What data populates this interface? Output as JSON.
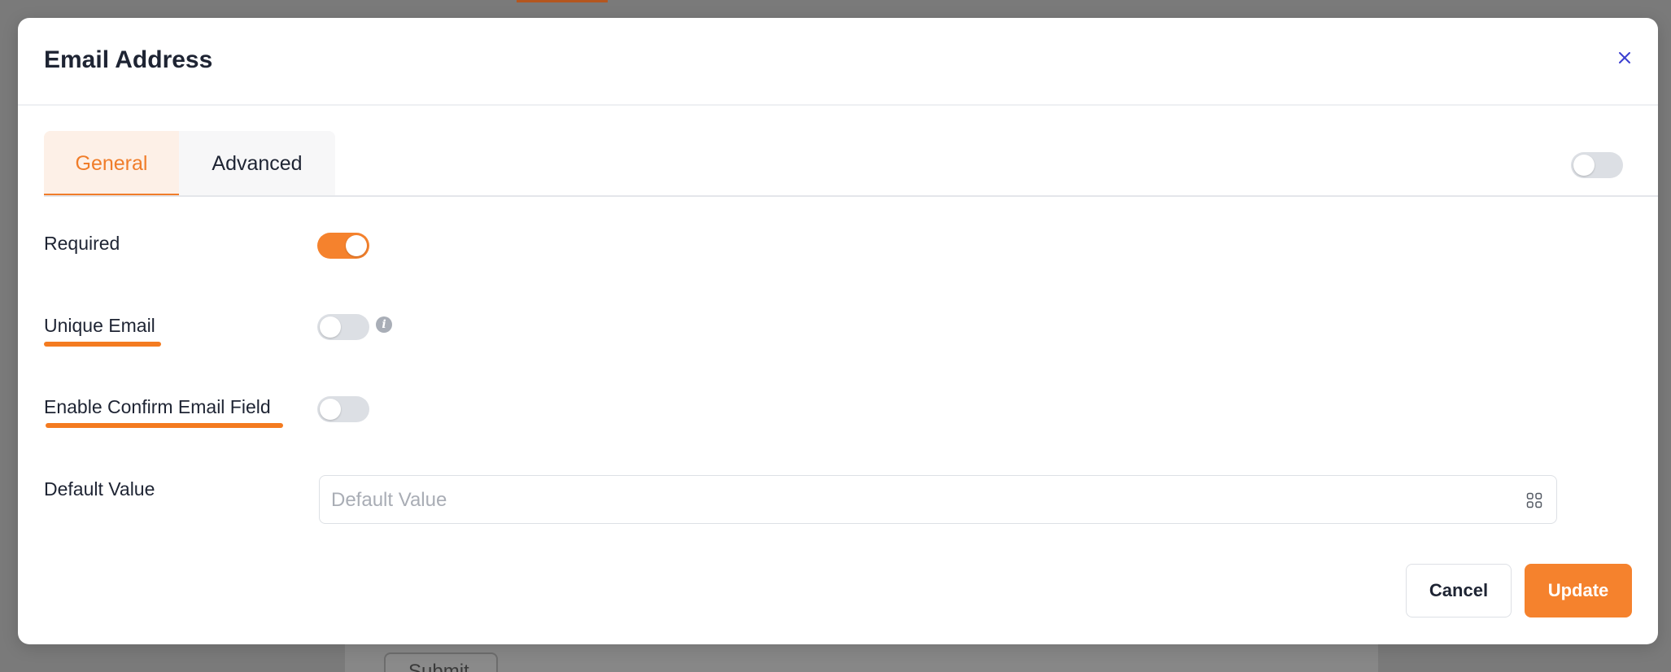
{
  "background": {
    "submit_label": "Submit"
  },
  "modal": {
    "title": "Email Address",
    "close_icon": "close-icon",
    "tabs": [
      {
        "label": "General",
        "active": true
      },
      {
        "label": "Advanced",
        "active": false
      }
    ],
    "header_toggle": {
      "on": false
    },
    "fields": {
      "required": {
        "label": "Required",
        "on": true
      },
      "unique_email": {
        "label": "Unique Email",
        "on": false,
        "icon": "info-icon"
      },
      "confirm_email": {
        "label": "Enable Confirm Email Field",
        "on": false
      },
      "default_value": {
        "label": "Default Value",
        "placeholder": "Default Value",
        "value": "",
        "icon": "grid-icon"
      }
    },
    "buttons": {
      "cancel": "Cancel",
      "update": "Update"
    }
  },
  "colors": {
    "accent": "#f5822d",
    "overlay": "#7a7a7a",
    "text": "#1e2433",
    "toggle_off": "#dcdfe4"
  }
}
